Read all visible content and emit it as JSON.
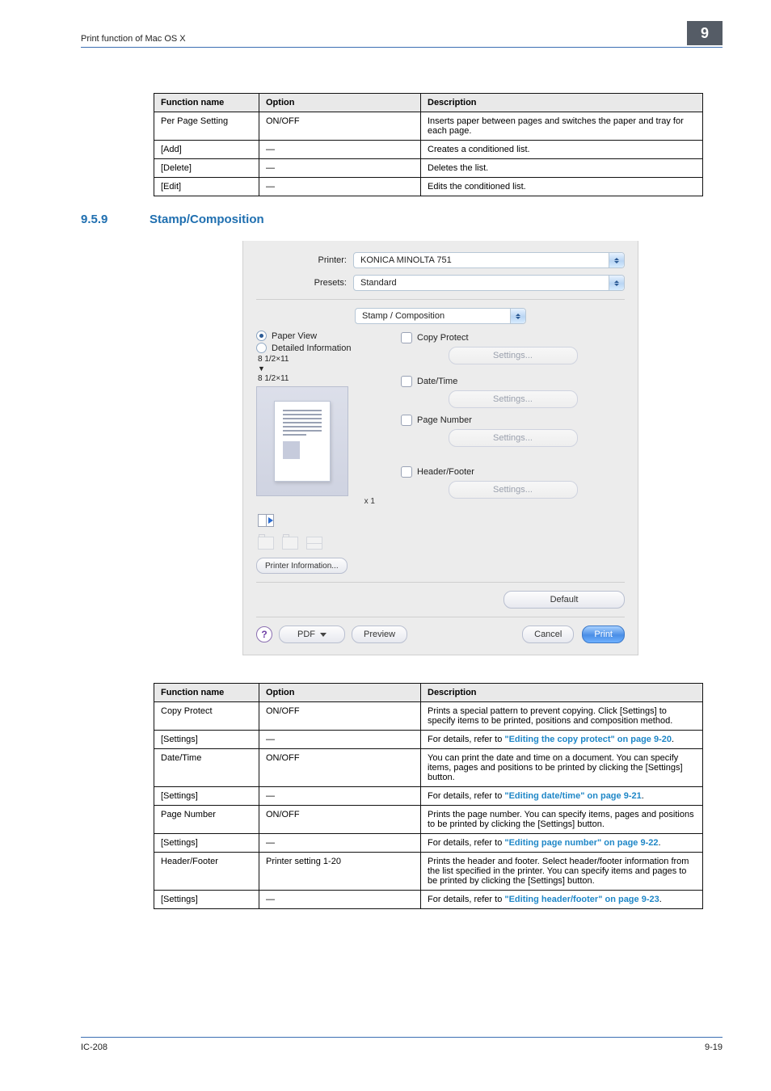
{
  "page": {
    "header_left": "Print function of Mac OS X",
    "chapter_number": "9",
    "footer_left": "IC-208",
    "footer_right": "9-19"
  },
  "table_headers": {
    "function": "Function name",
    "option": "Option",
    "description": "Description"
  },
  "table1": {
    "rows": [
      {
        "func": "Per Page Setting",
        "opt": "ON/OFF",
        "desc": "Inserts paper between pages and switches the paper and tray for each page."
      },
      {
        "func": "[Add]",
        "opt": "—",
        "desc": "Creates a conditioned list."
      },
      {
        "func": "[Delete]",
        "opt": "—",
        "desc": "Deletes the list."
      },
      {
        "func": "[Edit]",
        "opt": "—",
        "desc": "Edits the conditioned list."
      }
    ]
  },
  "section": {
    "number": "9.5.9",
    "title": "Stamp/Composition"
  },
  "dialog": {
    "labels": {
      "printer": "Printer:",
      "presets": "Presets:"
    },
    "printer": "KONICA MINOLTA 751",
    "presets": "Standard",
    "pane": "Stamp / Composition",
    "radios": {
      "paper_view": "Paper View",
      "detailed": "Detailed Information"
    },
    "paper_size_top": "8 1/2×11",
    "paper_size_bottom": "8 1/2×11",
    "arrow": "▼",
    "scale": "x 1",
    "printer_info": "Printer Information...",
    "options": {
      "copy_protect": "Copy Protect",
      "date_time": "Date/Time",
      "page_number": "Page Number",
      "header_footer": "Header/Footer",
      "settings": "Settings..."
    },
    "default": "Default",
    "help": "?",
    "pdf": "PDF",
    "preview": "Preview",
    "cancel": "Cancel",
    "print": "Print"
  },
  "table2": {
    "rows": [
      {
        "func": "Copy Protect",
        "opt": "ON/OFF",
        "desc_pre": "Prints a special pattern to prevent copying. Click [Settings] to specify items to be printed, positions and composition method."
      },
      {
        "func": "[Settings]",
        "opt": "—",
        "desc_pre": "For details, refer to ",
        "link": "\"Editing the copy protect\" on page 9-20",
        "desc_post": "."
      },
      {
        "func": "Date/Time",
        "opt": "ON/OFF",
        "desc_pre": "You can print the date and time on a document. You can specify items, pages and positions to be printed by clicking the [Settings] button."
      },
      {
        "func": "[Settings]",
        "opt": "—",
        "desc_pre": "For details, refer to ",
        "link": "\"Editing date/time\" on page 9-21",
        "desc_post": "."
      },
      {
        "func": "Page Number",
        "opt": "ON/OFF",
        "desc_pre": "Prints the page number. You can specify items, pages and positions to be printed by clicking the [Settings] button."
      },
      {
        "func": "[Settings]",
        "opt": "—",
        "desc_pre": "For details, refer to ",
        "link": "\"Editing page number\" on page 9-22",
        "desc_post": "."
      },
      {
        "func": "Header/Footer",
        "opt": "Printer setting 1-20",
        "desc_pre": "Prints the header and footer. Select header/footer information from the list specified in the printer. You can specify items and pages to be printed by clicking the [Settings] button."
      },
      {
        "func": "[Settings]",
        "opt": "—",
        "desc_pre": "For details, refer to ",
        "link": "\"Editing header/footer\" on page 9-23",
        "desc_post": "."
      }
    ]
  }
}
